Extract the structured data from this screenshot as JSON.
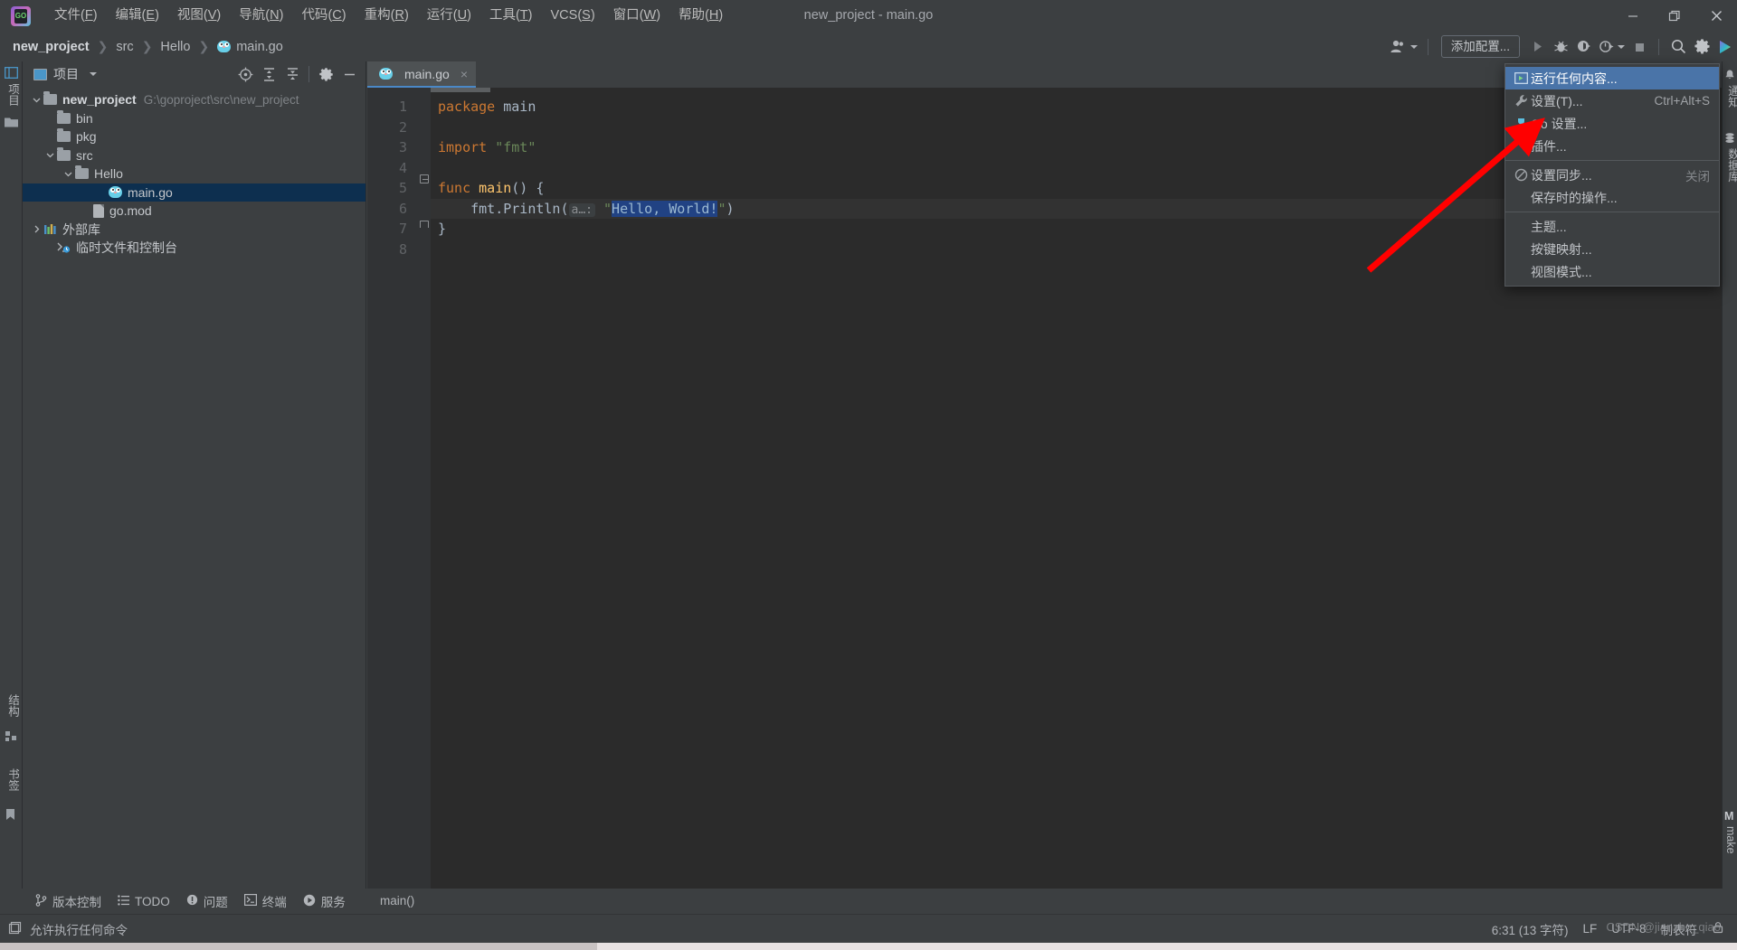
{
  "titlebar": {
    "app_title": "new_project - main.go",
    "logo_text": "GO",
    "menus": [
      {
        "label": "文件",
        "key": "F"
      },
      {
        "label": "编辑",
        "key": "E"
      },
      {
        "label": "视图",
        "key": "V"
      },
      {
        "label": "导航",
        "key": "N"
      },
      {
        "label": "代码",
        "key": "C"
      },
      {
        "label": "重构",
        "key": "R"
      },
      {
        "label": "运行",
        "key": "U"
      },
      {
        "label": "工具",
        "key": "T"
      },
      {
        "label": "VCS",
        "key": "S"
      },
      {
        "label": "窗口",
        "key": "W"
      },
      {
        "label": "帮助",
        "key": "H"
      }
    ],
    "window_controls": [
      "minimize-icon",
      "maximize-icon",
      "close-icon"
    ]
  },
  "navbar": {
    "breadcrumbs": [
      "new_project",
      "src",
      "Hello",
      "main.go"
    ],
    "add_config_label": "添加配置...",
    "icons": [
      "user-avatar-icon",
      "run-icon",
      "debug-icon",
      "coverage-icon",
      "profiler-icon",
      "stop-icon",
      "search-icon",
      "settings-gear-icon",
      "ide-logo-icon"
    ]
  },
  "left_strip": {
    "top_label": "项目",
    "bottom_labels": [
      "结构",
      "书签"
    ]
  },
  "right_strip": {
    "labels": [
      "通知",
      "数据库"
    ],
    "bottom_label": "make",
    "bottom_prefix": "M"
  },
  "project_panel": {
    "title": "项目",
    "toolbar_icons": [
      "select-opened-file-icon",
      "expand-all-icon",
      "collapse-all-icon",
      "settings-gear-icon",
      "hide-panel-icon"
    ],
    "tree": [
      {
        "label": "new_project",
        "path": "G:\\goproject\\src\\new_project",
        "indent": 0,
        "type": "folder",
        "arrow": "down",
        "bold": true,
        "selected": false
      },
      {
        "label": "bin",
        "path": "",
        "indent": 1,
        "type": "folder",
        "arrow": "",
        "bold": false,
        "selected": false
      },
      {
        "label": "pkg",
        "path": "",
        "indent": 1,
        "type": "folder",
        "arrow": "",
        "bold": false,
        "selected": false
      },
      {
        "label": "src",
        "path": "",
        "indent": 1,
        "type": "folder",
        "arrow": "down",
        "bold": false,
        "selected": false
      },
      {
        "label": "Hello",
        "path": "",
        "indent": 2,
        "type": "folder",
        "arrow": "down",
        "bold": false,
        "selected": false
      },
      {
        "label": "main.go",
        "path": "",
        "indent": 3,
        "type": "go",
        "arrow": "",
        "bold": false,
        "selected": true
      },
      {
        "label": "go.mod",
        "path": "",
        "indent": 2,
        "type": "mod",
        "arrow": "",
        "bold": false,
        "selected": false
      },
      {
        "label": "外部库",
        "path": "",
        "indent": 0,
        "type": "library",
        "arrow": "right",
        "bold": false,
        "selected": false
      },
      {
        "label": "临时文件和控制台",
        "path": "",
        "indent": 0,
        "type": "scratch",
        "arrow": "",
        "bold": false,
        "selected": false
      }
    ]
  },
  "editor": {
    "tab_label": "main.go",
    "tab_close": "×",
    "line_numbers": [
      "1",
      "2",
      "3",
      "4",
      "5",
      "6",
      "7",
      "8"
    ],
    "code_lines": [
      {
        "n": 1,
        "segments": [
          {
            "t": "package ",
            "c": "kw"
          },
          {
            "t": "main",
            "c": "pl"
          }
        ]
      },
      {
        "n": 2,
        "segments": []
      },
      {
        "n": 3,
        "segments": [
          {
            "t": "import ",
            "c": "kw"
          },
          {
            "t": "\"fmt\"",
            "c": "st"
          }
        ]
      },
      {
        "n": 4,
        "segments": []
      },
      {
        "n": 5,
        "segments": [
          {
            "t": "func ",
            "c": "kw"
          },
          {
            "t": "main",
            "c": "fn"
          },
          {
            "t": "() {",
            "c": "pl"
          }
        ]
      },
      {
        "n": 6,
        "segments": [
          {
            "t": "    fmt.Println(",
            "c": "pl"
          },
          {
            "t": " a…: ",
            "c": "hint"
          },
          {
            "t": "\"",
            "c": "st"
          },
          {
            "t": "Hello, World!",
            "c": "selstr"
          },
          {
            "t": "\")",
            "c": "st"
          }
        ]
      },
      {
        "n": 7,
        "segments": [
          {
            "t": "}",
            "c": "pl"
          }
        ]
      },
      {
        "n": 8,
        "segments": []
      }
    ],
    "status_breadcrumb": "main()"
  },
  "popup_menu": {
    "items": [
      {
        "label": "运行任何内容...",
        "icon": "run-anything-icon",
        "shortcut": "",
        "state": "",
        "highlighted": true,
        "separator_after": false
      },
      {
        "label": "设置(T)...",
        "icon": "wrench-icon",
        "shortcut": "Ctrl+Alt+S",
        "state": "",
        "highlighted": false,
        "separator_after": false
      },
      {
        "label": "Go 设置...",
        "icon": "go-settings-icon",
        "shortcut": "",
        "state": "",
        "highlighted": false,
        "separator_after": false
      },
      {
        "label": "插件...",
        "icon": "",
        "shortcut": "",
        "state": "",
        "highlighted": false,
        "separator_after": true
      },
      {
        "label": "设置同步...",
        "icon": "sync-disabled-icon",
        "shortcut": "",
        "state": "关闭",
        "highlighted": false,
        "separator_after": false
      },
      {
        "label": "保存时的操作...",
        "icon": "",
        "shortcut": "",
        "state": "",
        "highlighted": false,
        "separator_after": true
      },
      {
        "label": "主题...",
        "icon": "",
        "shortcut": "",
        "state": "",
        "highlighted": false,
        "separator_after": false
      },
      {
        "label": "按键映射...",
        "icon": "",
        "shortcut": "",
        "state": "",
        "highlighted": false,
        "separator_after": false
      },
      {
        "label": "视图模式...",
        "icon": "",
        "shortcut": "",
        "state": "",
        "highlighted": false,
        "separator_after": false
      }
    ]
  },
  "bottom_windows": [
    {
      "label": "版本控制",
      "icon": "branch-icon"
    },
    {
      "label": "TODO",
      "icon": "list-icon"
    },
    {
      "label": "问题",
      "icon": "warning-icon"
    },
    {
      "label": "终端",
      "icon": "terminal-icon"
    },
    {
      "label": "服务",
      "icon": "services-play-icon"
    }
  ],
  "statusbar": {
    "left_text": "允许执行任何命令",
    "left_icon": "terminal-box-icon",
    "caret_position": "6:31 (13 字符)",
    "line_separator": "LF",
    "encoding": "UTF-8",
    "indent": "制表符",
    "lock_icon": "lock-icon",
    "watermark": "CSDN @jianzhu_qiao"
  },
  "colors": {
    "accent": "#4a88c7",
    "menu_highlight": "#4a74a8",
    "selection": "#214283",
    "tree_selection": "#0d2f4f",
    "panel_bg": "#3c3f41",
    "editor_bg": "#2b2b2b",
    "gutter_bg": "#313335",
    "annotation_arrow": "#ff0000"
  }
}
